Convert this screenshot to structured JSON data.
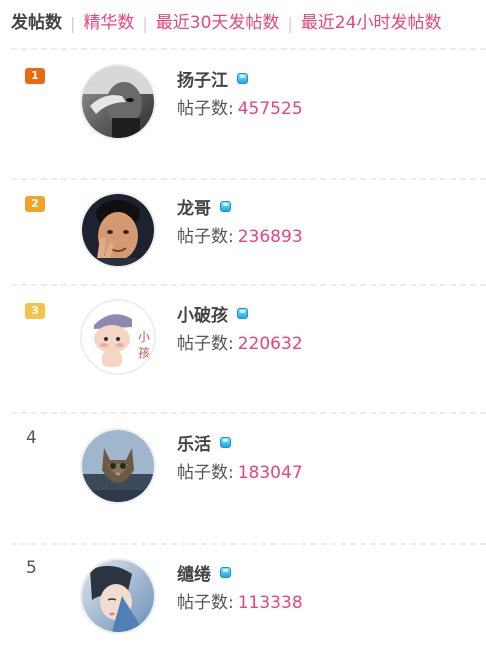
{
  "tabs": {
    "active": "发帖数",
    "items": [
      "精华数",
      "最近30天发帖数",
      "最近24小时发帖数"
    ],
    "separator": "|"
  },
  "count_label": "帖子数:",
  "colors": {
    "accent": "#e8457a",
    "rank1": "#e86a10",
    "rank2": "#f0a52a",
    "rank3": "#f5c24a",
    "vip": "#1fa8e8"
  },
  "users": [
    {
      "rank": "1",
      "name": "扬子江",
      "posts": "457525",
      "avatar": "bw-photo-avatar"
    },
    {
      "rank": "2",
      "name": "龙哥",
      "posts": "236893",
      "avatar": "man-peace-sign-avatar"
    },
    {
      "rank": "3",
      "name": "小破孩",
      "posts": "220632",
      "avatar": "cartoon-boy-avatar"
    },
    {
      "rank": "4",
      "name": "乐活",
      "posts": "183047",
      "avatar": "kitten-avatar"
    },
    {
      "rank": "5",
      "name": "缱绻",
      "posts": "113338",
      "avatar": "girl-portrait-avatar"
    }
  ]
}
